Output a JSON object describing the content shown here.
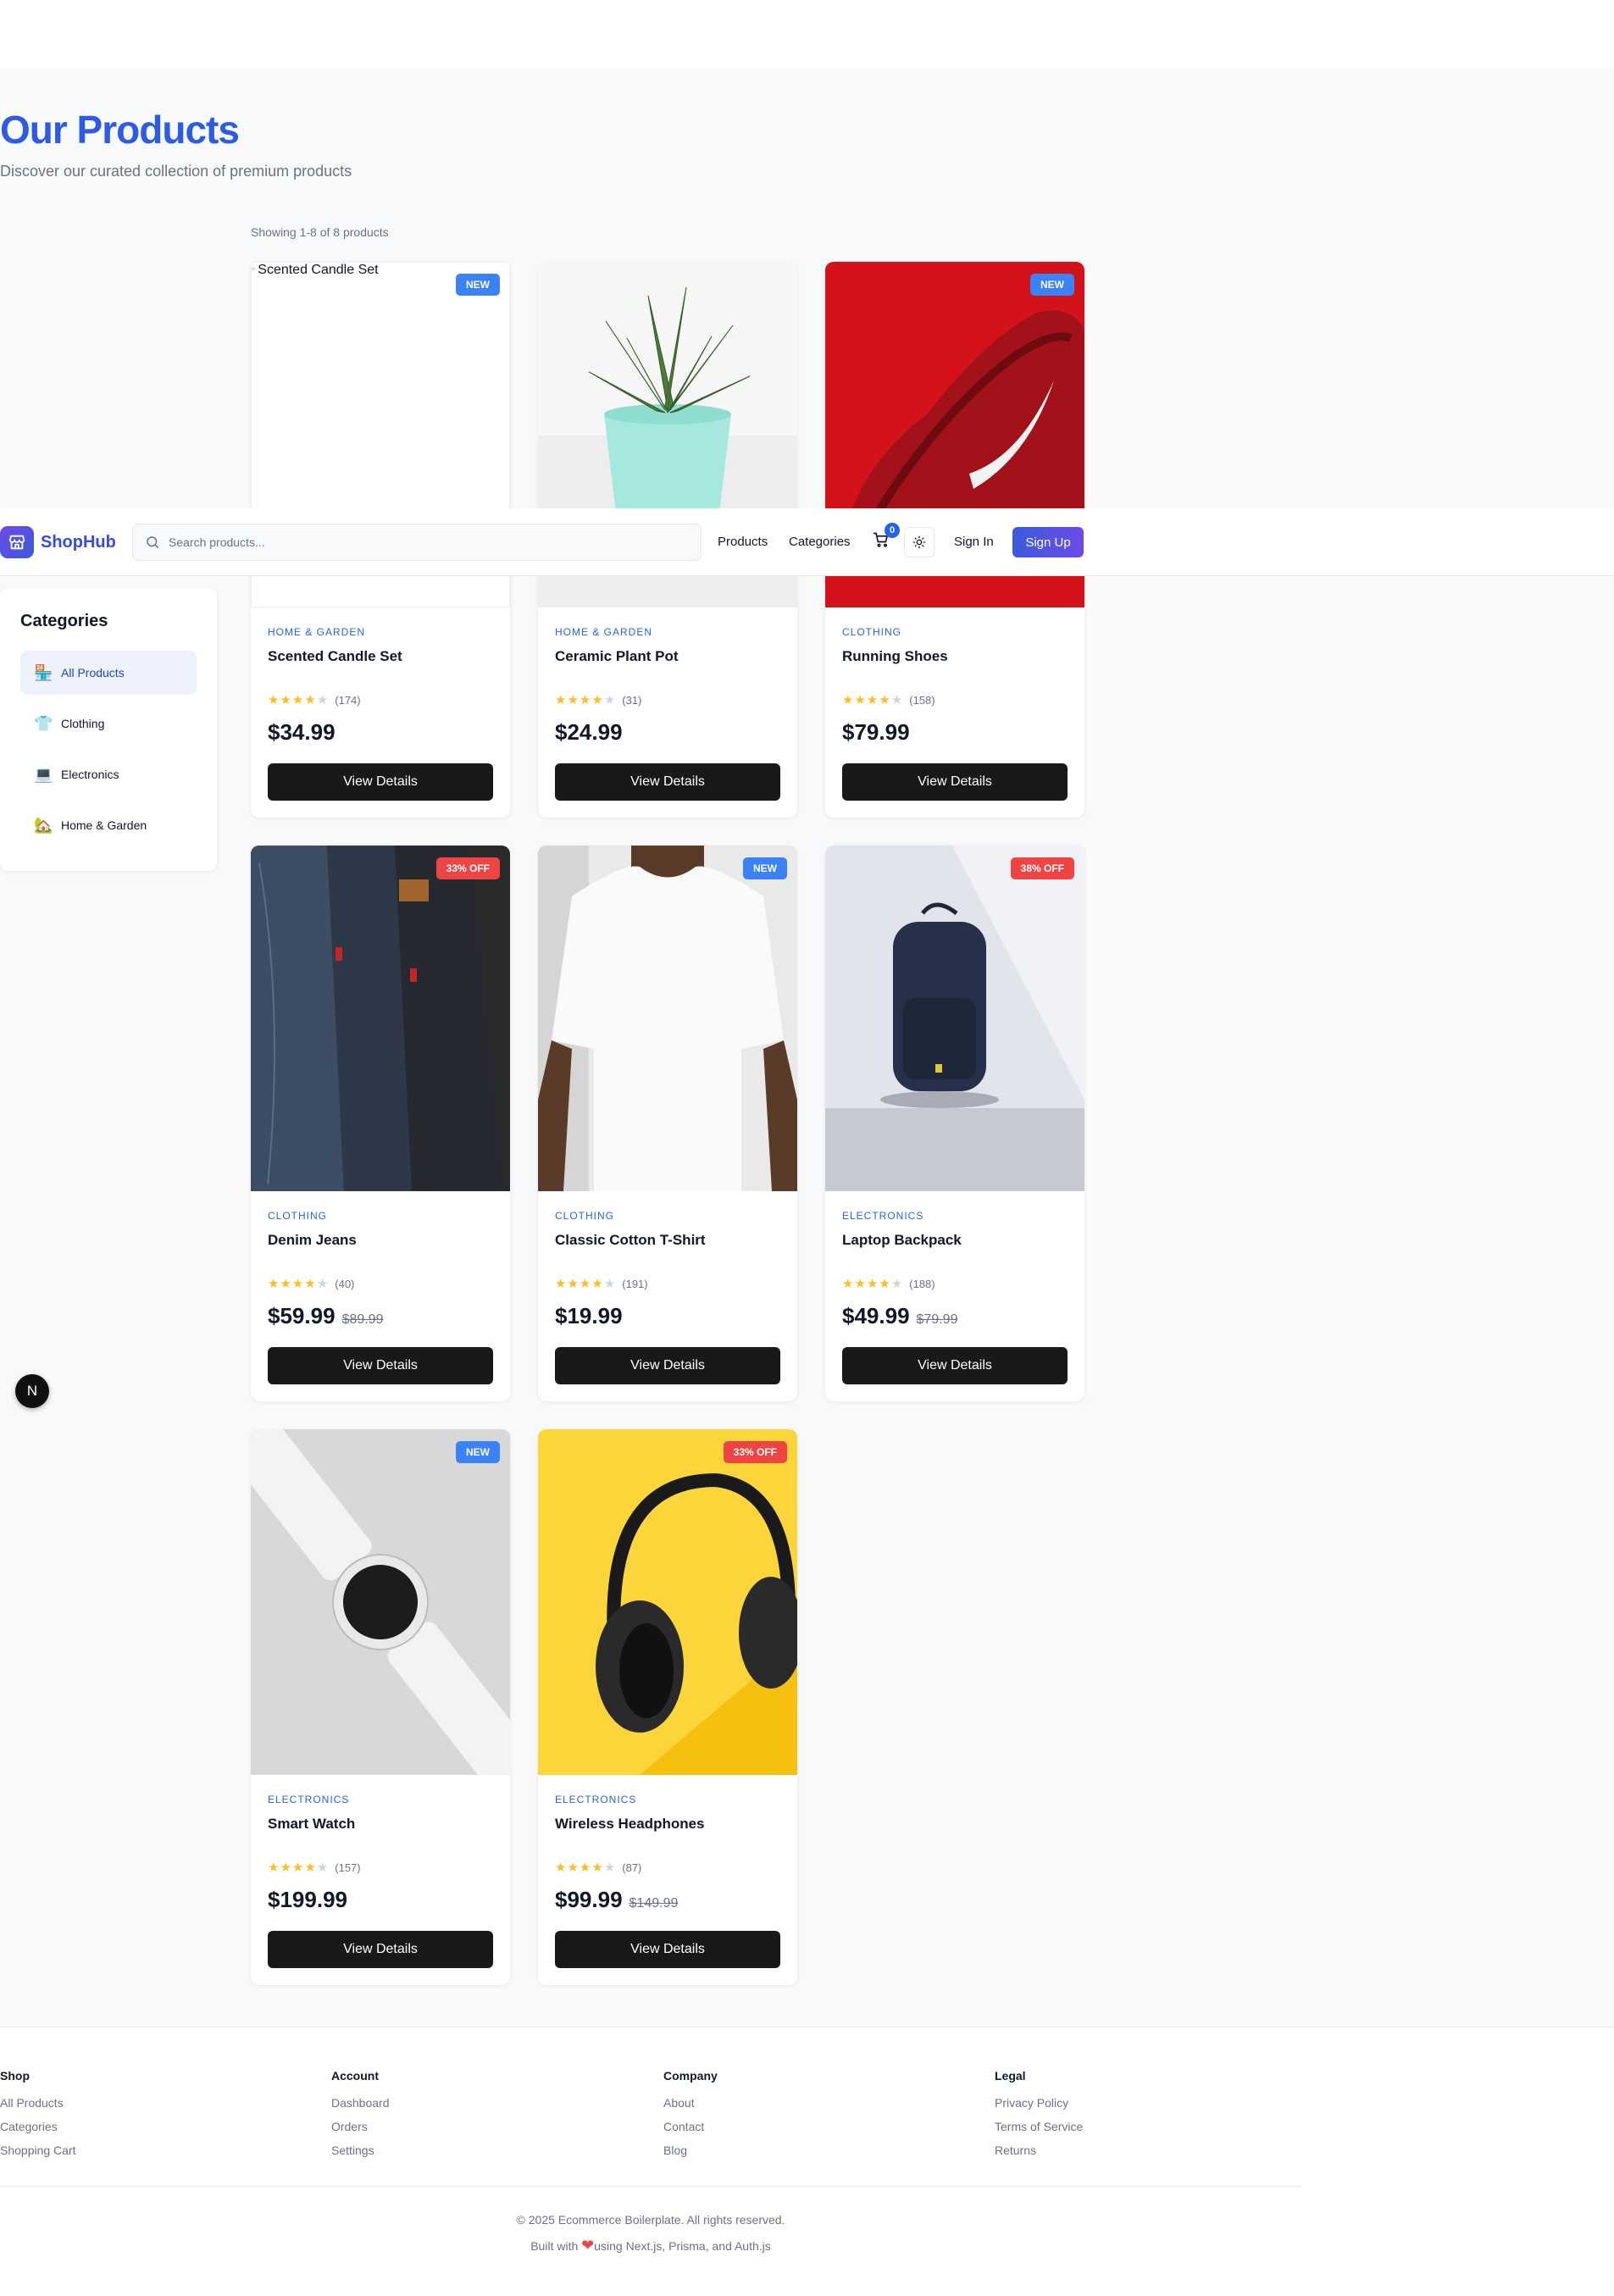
{
  "header": {
    "title": "Our Products",
    "subtitle": "Discover our curated collection of premium products",
    "showing": "Showing 1-8 of 8 products"
  },
  "navbar": {
    "brand": "ShopHub",
    "search_placeholder": "Search products...",
    "links": [
      "Products",
      "Categories"
    ],
    "cart_count": "0",
    "signin": "Sign In",
    "signup": "Sign Up"
  },
  "sidebar": {
    "title": "Categories",
    "items": [
      {
        "label": "All Products",
        "icon": "store-icon",
        "glyph": "🏪",
        "active": true
      },
      {
        "label": "Clothing",
        "icon": "shirt-icon",
        "glyph": "👕",
        "active": false
      },
      {
        "label": "Electronics",
        "icon": "laptop-icon",
        "glyph": "💻",
        "active": false
      },
      {
        "label": "Home & Garden",
        "icon": "house-garden-icon",
        "glyph": "🏡",
        "active": false
      }
    ]
  },
  "products": [
    {
      "category": "HOME & GARDEN",
      "name": "Scented Candle Set",
      "rating": 4,
      "reviews": "(174)",
      "price": "$34.99",
      "old_price": "",
      "badge": "NEW",
      "badge_type": "new",
      "image": "broken",
      "alt": "Scented Candle Set"
    },
    {
      "category": "HOME & GARDEN",
      "name": "Ceramic Plant Pot",
      "rating": 4,
      "reviews": "(31)",
      "price": "$24.99",
      "old_price": "",
      "badge": "",
      "badge_type": "",
      "image": "plant"
    },
    {
      "category": "CLOTHING",
      "name": "Running Shoes",
      "rating": 4,
      "reviews": "(158)",
      "price": "$79.99",
      "old_price": "",
      "badge": "NEW",
      "badge_type": "new",
      "image": "shoe"
    },
    {
      "category": "CLOTHING",
      "name": "Denim Jeans",
      "rating": 4,
      "reviews": "(40)",
      "price": "$59.99",
      "old_price": "$89.99",
      "badge": "33% OFF",
      "badge_type": "off",
      "image": "jeans"
    },
    {
      "category": "CLOTHING",
      "name": "Classic Cotton T-Shirt",
      "rating": 4,
      "reviews": "(191)",
      "price": "$19.99",
      "old_price": "",
      "badge": "NEW",
      "badge_type": "new",
      "image": "tshirt"
    },
    {
      "category": "ELECTRONICS",
      "name": "Laptop Backpack",
      "rating": 4,
      "reviews": "(188)",
      "price": "$49.99",
      "old_price": "$79.99",
      "badge": "38% OFF",
      "badge_type": "off",
      "image": "backpack"
    },
    {
      "category": "ELECTRONICS",
      "name": "Smart Watch",
      "rating": 4,
      "reviews": "(157)",
      "price": "$199.99",
      "old_price": "",
      "badge": "NEW",
      "badge_type": "new",
      "image": "watch"
    },
    {
      "category": "ELECTRONICS",
      "name": "Wireless Headphones",
      "rating": 4,
      "reviews": "(87)",
      "price": "$99.99",
      "old_price": "$149.99",
      "badge": "33% OFF",
      "badge_type": "off",
      "image": "headphones"
    }
  ],
  "view_details_label": "View Details",
  "dev_indicator": "N",
  "footer": {
    "columns": [
      {
        "heading": "Shop",
        "links": [
          "All Products",
          "Categories",
          "Shopping Cart"
        ]
      },
      {
        "heading": "Account",
        "links": [
          "Dashboard",
          "Orders",
          "Settings"
        ]
      },
      {
        "heading": "Company",
        "links": [
          "About",
          "Contact",
          "Blog"
        ]
      },
      {
        "heading": "Legal",
        "links": [
          "Privacy Policy",
          "Terms of Service",
          "Returns"
        ]
      }
    ],
    "copyright": "© 2025 Ecommerce Boilerplate. All rights reserved.",
    "built_prefix": "Built with",
    "built_suffix": "using Next.js, Prisma, and Auth.js"
  },
  "colors": {
    "accent": "#2d5be3",
    "new_badge": "#3b82f6",
    "off_badge": "#ef4444",
    "button": "#18191b",
    "star": "#fbbf24"
  }
}
